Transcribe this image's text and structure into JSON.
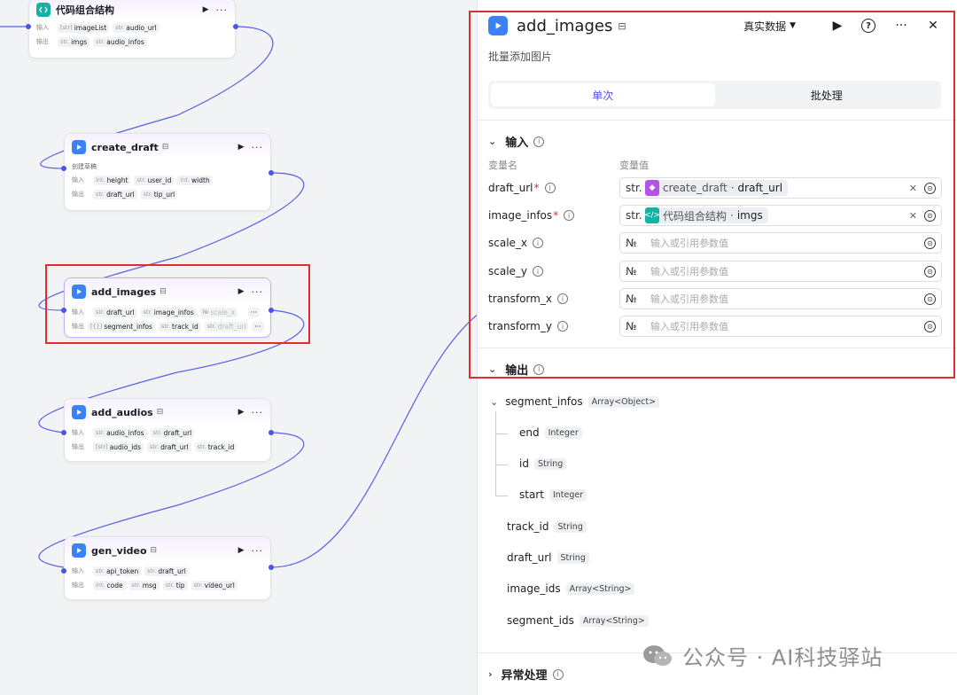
{
  "canvas": {
    "nodes": {
      "code": {
        "title": "代码组合结构",
        "input_label": "输入",
        "output_label": "输出",
        "inputs": [
          {
            "type": "[str]",
            "name": "imageList"
          },
          {
            "type": "str.",
            "name": "audio_url"
          }
        ],
        "outputs": [
          {
            "type": "str.",
            "name": "imgs"
          },
          {
            "type": "str.",
            "name": "audio_infos"
          }
        ]
      },
      "create_draft": {
        "title": "create_draft",
        "desc": "创建草稿",
        "input_label": "输入",
        "output_label": "输出",
        "inputs": [
          {
            "type": "int.",
            "name": "height"
          },
          {
            "type": "str.",
            "name": "user_id"
          },
          {
            "type": "int.",
            "name": "width"
          }
        ],
        "outputs": [
          {
            "type": "str.",
            "name": "draft_url"
          },
          {
            "type": "str.",
            "name": "tip_url"
          }
        ]
      },
      "add_images": {
        "title": "add_images",
        "input_label": "输入",
        "output_label": "输出",
        "inputs": [
          {
            "type": "str.",
            "name": "draft_url"
          },
          {
            "type": "str.",
            "name": "image_infos"
          },
          {
            "type": "№",
            "name": "scale_x"
          }
        ],
        "outputs": [
          {
            "type": "[{}]",
            "name": "segment_infos"
          },
          {
            "type": "str.",
            "name": "track_id"
          },
          {
            "type": "str.",
            "name": "draft_url"
          }
        ],
        "more": "···"
      },
      "add_audios": {
        "title": "add_audios",
        "input_label": "输入",
        "output_label": "输出",
        "inputs": [
          {
            "type": "str.",
            "name": "audio_infos"
          },
          {
            "type": "str.",
            "name": "draft_url"
          }
        ],
        "outputs": [
          {
            "type": "[str]",
            "name": "audio_ids"
          },
          {
            "type": "str.",
            "name": "draft_url"
          },
          {
            "type": "str.",
            "name": "track_id"
          }
        ]
      },
      "gen_video": {
        "title": "gen_video",
        "input_label": "输入",
        "output_label": "输出",
        "inputs": [
          {
            "type": "str.",
            "name": "api_token"
          },
          {
            "type": "str.",
            "name": "draft_url"
          }
        ],
        "outputs": [
          {
            "type": "int.",
            "name": "code"
          },
          {
            "type": "str.",
            "name": "msg"
          },
          {
            "type": "str.",
            "name": "tip"
          },
          {
            "type": "str.",
            "name": "video_url"
          }
        ]
      }
    }
  },
  "panel": {
    "title": "add_images",
    "data_select": "真实数据",
    "help": "?",
    "more": "···",
    "close": "✕",
    "desc": "批量添加图片",
    "tabs": [
      "单次",
      "批处理"
    ],
    "input_section": "输入",
    "col_name": "变量名",
    "col_value": "变量值",
    "inputs": [
      {
        "name": "draft_url",
        "required": true,
        "type": "str.",
        "ref_node": "create_draft",
        "ref_field": "draft_url",
        "ref_icon": "purple"
      },
      {
        "name": "image_infos",
        "required": true,
        "type": "str.",
        "ref_node": "代码组合结构",
        "ref_field": "imgs",
        "ref_icon": "teal"
      },
      {
        "name": "scale_x",
        "required": false,
        "type": "№",
        "placeholder": "输入或引用参数值"
      },
      {
        "name": "scale_y",
        "required": false,
        "type": "№",
        "placeholder": "输入或引用参数值"
      },
      {
        "name": "transform_x",
        "required": false,
        "type": "№",
        "placeholder": "输入或引用参数值"
      },
      {
        "name": "transform_y",
        "required": false,
        "type": "№",
        "placeholder": "输入或引用参数值"
      }
    ],
    "output_section": "输出",
    "outputs": {
      "segment_infos": {
        "name": "segment_infos",
        "type": "Array<Object>"
      },
      "children": [
        {
          "name": "end",
          "type": "Integer"
        },
        {
          "name": "id",
          "type": "String"
        },
        {
          "name": "start",
          "type": "Integer"
        }
      ],
      "rest": [
        {
          "name": "track_id",
          "type": "String"
        },
        {
          "name": "draft_url",
          "type": "String"
        },
        {
          "name": "image_ids",
          "type": "Array<String>"
        },
        {
          "name": "segment_ids",
          "type": "Array<String>"
        }
      ]
    },
    "error_section": "异常处理"
  },
  "watermark": "公众号 · AI科技驿站",
  "colors": {
    "accent": "#4d53e8",
    "selection": "#e02d2d",
    "edge": "#4d53e8"
  }
}
